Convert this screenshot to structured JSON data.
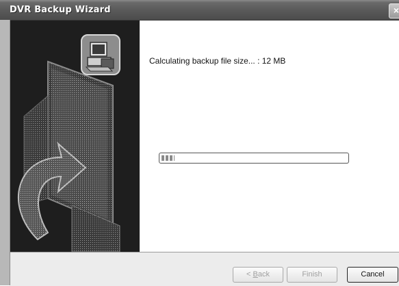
{
  "window": {
    "title": "DVR Backup Wizard",
    "close_glyph": "×"
  },
  "status": {
    "message": "Calculating backup file size... : 12 MB"
  },
  "progress": {
    "fraction": 0.07
  },
  "buttons": {
    "back_prefix": "< ",
    "back_mnemonic": "B",
    "back_rest": "ack",
    "finish": "Finish",
    "cancel": "Cancel"
  },
  "icons": {
    "wizard": "computer-install-icon"
  }
}
